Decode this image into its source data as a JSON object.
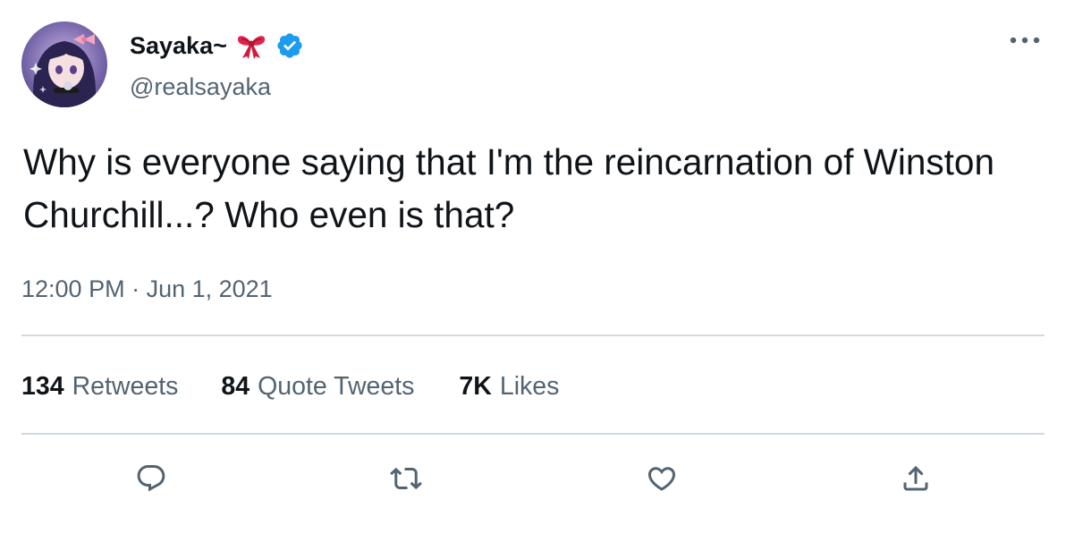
{
  "author": {
    "display_name": "Sayaka~",
    "handle": "@realsayaka",
    "name_emoji": "ribbon-icon",
    "verified": true,
    "verified_color": "#1d9bf0"
  },
  "tweet": {
    "text": "Why is everyone saying that I'm the reincarnation of Winston Churchill...? Who even is that?",
    "time": "12:00 PM",
    "separator": " · ",
    "date": "Jun 1, 2021"
  },
  "stats": {
    "retweets": {
      "count": "134",
      "label": "Retweets"
    },
    "quote_tweets": {
      "count": "84",
      "label": "Quote Tweets"
    },
    "likes": {
      "count": "7K",
      "label": "Likes"
    }
  },
  "actions": [
    "reply-icon",
    "retweet-icon",
    "like-icon",
    "share-icon"
  ],
  "colors": {
    "text_primary": "#0f1419",
    "text_secondary": "#536471",
    "divider": "#cfd9de"
  }
}
